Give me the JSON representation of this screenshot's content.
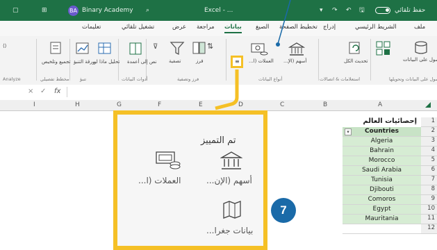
{
  "titlebar": {
    "autosave_label": "حفظ تلقائي",
    "app_title": "Excel - ...",
    "user_initials": "BA",
    "user_name": "Binary Academy"
  },
  "ribbon_tabs": [
    "ملف",
    "الشريط الرئيسي",
    "إدراج",
    "تخطيط الصفحة",
    "الصيغ",
    "بيانات",
    "مراجعة",
    "عرض",
    "تشغيل تلقائي",
    "تعليمات"
  ],
  "active_tab": "بيانات",
  "ribbon": {
    "get_data_label": "الحصول على البيانات",
    "refresh_all_label": "تحديث الكل",
    "stocks_label": "أسهم (الإ...",
    "currencies_label": "العملات (ا...",
    "sort_label": "فرز",
    "filter_label": "تصفية",
    "text_to_columns_label": "نص إلى أعمدة",
    "what_if_label": "تحليل ماذا لو",
    "forecast_label": "ورقة التنبؤ",
    "group_label": "تجميع وتلخيص",
    "analyze_label": "Analyze",
    "group_get_data": "الحصول على البيانات وتحويلها",
    "group_queries": "استعلامات & اتصالات",
    "group_data_types": "أنواع البيانات",
    "group_sort_filter": "فرز وتصفية",
    "group_data_tools": "أدوات البيانات",
    "group_forecast": "تنبؤ",
    "group_outline": "مخطط تفصيلي"
  },
  "formula_bar": {
    "fx_label": "fx",
    "value": ""
  },
  "columns": [
    "A",
    "B",
    "C",
    "D",
    "E",
    "F",
    "G",
    "H",
    "I"
  ],
  "rows": [
    {
      "num": "1",
      "value": "إحصائيات العالم",
      "type": "title"
    },
    {
      "num": "2",
      "value": "Countries",
      "type": "header"
    },
    {
      "num": "3",
      "value": "Algeria",
      "type": "country"
    },
    {
      "num": "4",
      "value": "Bahrain",
      "type": "country"
    },
    {
      "num": "5",
      "value": "Morocco",
      "type": "country"
    },
    {
      "num": "6",
      "value": "Saudi Arabia",
      "type": "country"
    },
    {
      "num": "7",
      "value": "Tunisia",
      "type": "country"
    },
    {
      "num": "8",
      "value": "Djibouti",
      "type": "country"
    },
    {
      "num": "9",
      "value": "Comoros",
      "type": "country"
    },
    {
      "num": "10",
      "value": "Egypt",
      "type": "country"
    },
    {
      "num": "11",
      "value": "Mauritania",
      "type": "country"
    },
    {
      "num": "12",
      "value": "",
      "type": "empty"
    }
  ],
  "callout": {
    "title": "تم التمييز",
    "stocks": "أسهم (الإن...",
    "currencies": "العملات (ا...",
    "geography": "بيانات جغرا..."
  },
  "step_badge": "7",
  "colors": {
    "excel_green": "#1e7145",
    "highlight_yellow": "#f5c026",
    "badge_blue": "#1a6aa8",
    "country_fill": "#d6ecd3"
  }
}
